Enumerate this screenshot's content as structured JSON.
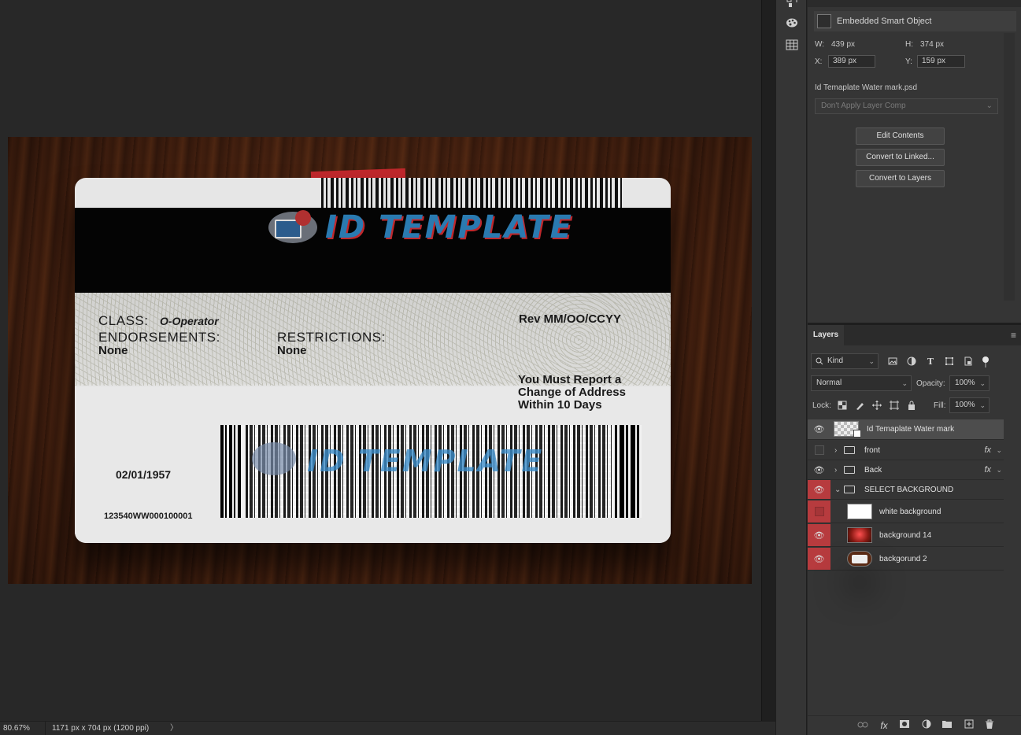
{
  "canvas": {
    "card": {
      "logo_text": "ID TEMPLATE",
      "class_label": "CLASS:",
      "class_value": "O-Operator",
      "endorsements_label": "ENDORSEMENTS:",
      "endorsements_value": "None",
      "restrictions_label": "RESTRICTIONS:",
      "restrictions_value": "None",
      "rev": "Rev MM/OO/CCYY",
      "notice_line1": "You Must Report a",
      "notice_line2": "Change of Address",
      "notice_line3": "Within 10 Days",
      "dob": "02/01/1957",
      "number": "123540WW000100001",
      "watermark_text": "ID TEMPLATE"
    }
  },
  "properties": {
    "header": "Embedded Smart Object",
    "w_label": "W:",
    "w_value": "439 px",
    "h_label": "H:",
    "h_value": "374 px",
    "x_label": "X:",
    "x_value": "389 px",
    "y_label": "Y:",
    "y_value": "159 px",
    "filename": "Id Temaplate Water mark.psd",
    "layer_comp": "Don't Apply Layer Comp",
    "buttons": [
      "Edit Contents",
      "Convert to Linked...",
      "Convert to Layers"
    ]
  },
  "layers": {
    "tab": "Layers",
    "filter_kind": "Kind",
    "blend_mode": "Normal",
    "opacity_label": "Opacity:",
    "opacity_value": "100%",
    "lock_label": "Lock:",
    "fill_label": "Fill:",
    "fill_value": "100%",
    "fx_symbol": "fx",
    "items": [
      {
        "name": "Id Temaplate Water mark",
        "visible": true,
        "selected": true
      },
      {
        "name": "front",
        "visible": false
      },
      {
        "name": "Back",
        "visible": true
      },
      {
        "name": "SELECT BACKGROUND",
        "visible": true
      },
      {
        "name": "white background",
        "visible": false
      },
      {
        "name": "background 14",
        "visible": true
      },
      {
        "name": "backgorund 2",
        "visible": true
      }
    ]
  },
  "status": {
    "zoom": "80.67%",
    "doc_info": "1171 px x 704 px (1200 ppi)",
    "arrow": "〉"
  },
  "colors": {
    "accent_red": "#b73b3e",
    "panel": "#353535",
    "canvas_bg": "#282828"
  }
}
